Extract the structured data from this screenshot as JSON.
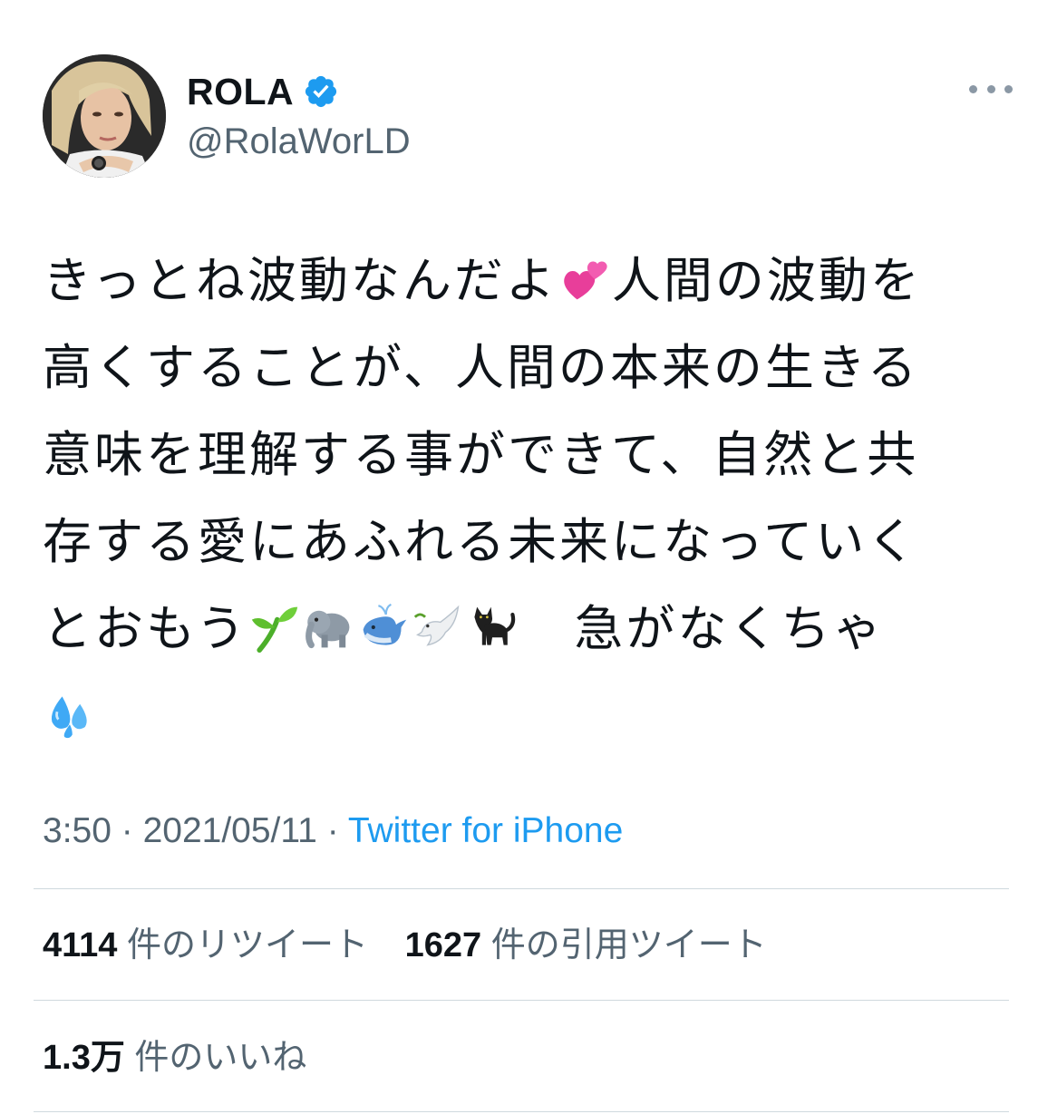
{
  "user": {
    "display_name": "ROLA",
    "handle": "@RolaWorLD",
    "verified": true
  },
  "tweet": {
    "line1a": "きっとね波動なんだよ",
    "line1b": "人間の波動を",
    "line2": "高くすることが、人間の本来の生きる",
    "line3": "意味を理解する事ができて、自然と共",
    "line4": "存する愛にあふれる未来になっていく",
    "line5a": "とおもう",
    "line5b": "急がなくちゃ",
    "emojis": [
      "two-hearts",
      "seedling",
      "elephant",
      "whale",
      "dove",
      "black-cat",
      "sweat-droplets"
    ]
  },
  "meta": {
    "time": "3:50",
    "separator": " · ",
    "date": "2021/05/11",
    "separator2": " · ",
    "source": "Twitter for iPhone"
  },
  "stats": {
    "retweets_count": "4114",
    "retweets_label": "件のリツイート",
    "quotes_count": "1627",
    "quotes_label": "件の引用ツイート",
    "likes_count": "1.3万",
    "likes_label": "件のいいね"
  },
  "colors": {
    "text": "#0f1419",
    "secondary": "#536471",
    "link": "#1d9bf0",
    "divider": "#cfd9de"
  }
}
